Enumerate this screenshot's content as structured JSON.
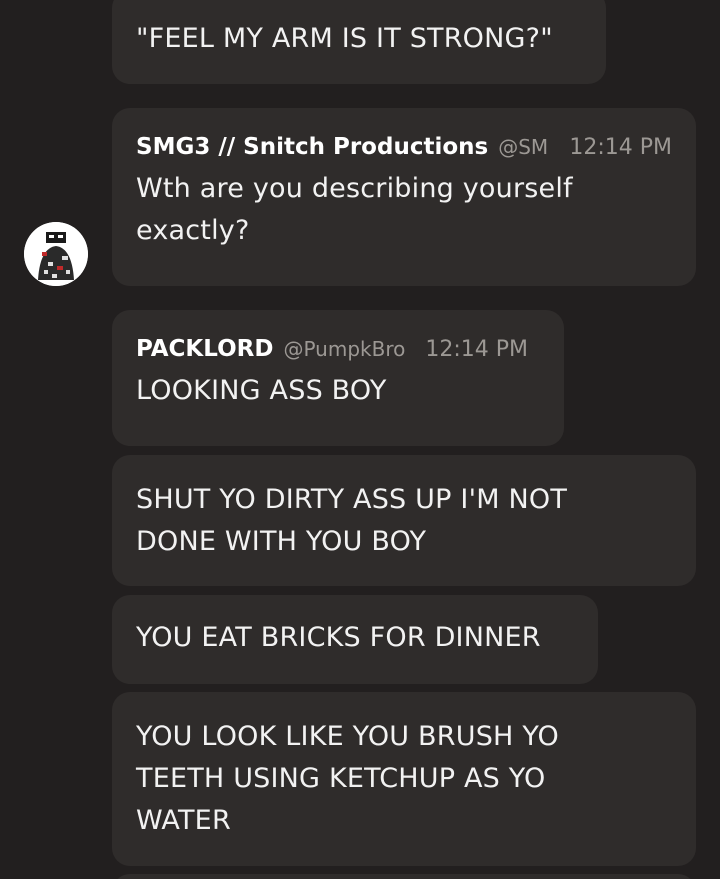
{
  "messages": [
    {
      "text": "\"FEEL MY ARM IS IT STRONG?\""
    },
    {
      "author": "SMG3 // Snitch Productions",
      "handle": "@SMG",
      "time": "12:14 PM",
      "text": "Wth are you describing yourself exactly?"
    },
    {
      "author": "PACKLORD",
      "handle": "@PumpkBro",
      "time": "12:14 PM",
      "text": "LOOKING ASS BOY"
    },
    {
      "text": "SHUT YO DIRTY ASS UP I'M NOT DONE WITH YOU BOY"
    },
    {
      "text": "YOU EAT BRICKS FOR DINNER"
    },
    {
      "text": "YOU LOOK LIKE YOU BRUSH YO TEETH USING KETCHUP AS YO WATER"
    }
  ],
  "colors": {
    "background": "#221f1f",
    "bubble": "#2f2c2b",
    "text": "#f2f2f2",
    "muted": "#9c9894"
  },
  "icons": {
    "avatar": "avatar-character-icon"
  }
}
